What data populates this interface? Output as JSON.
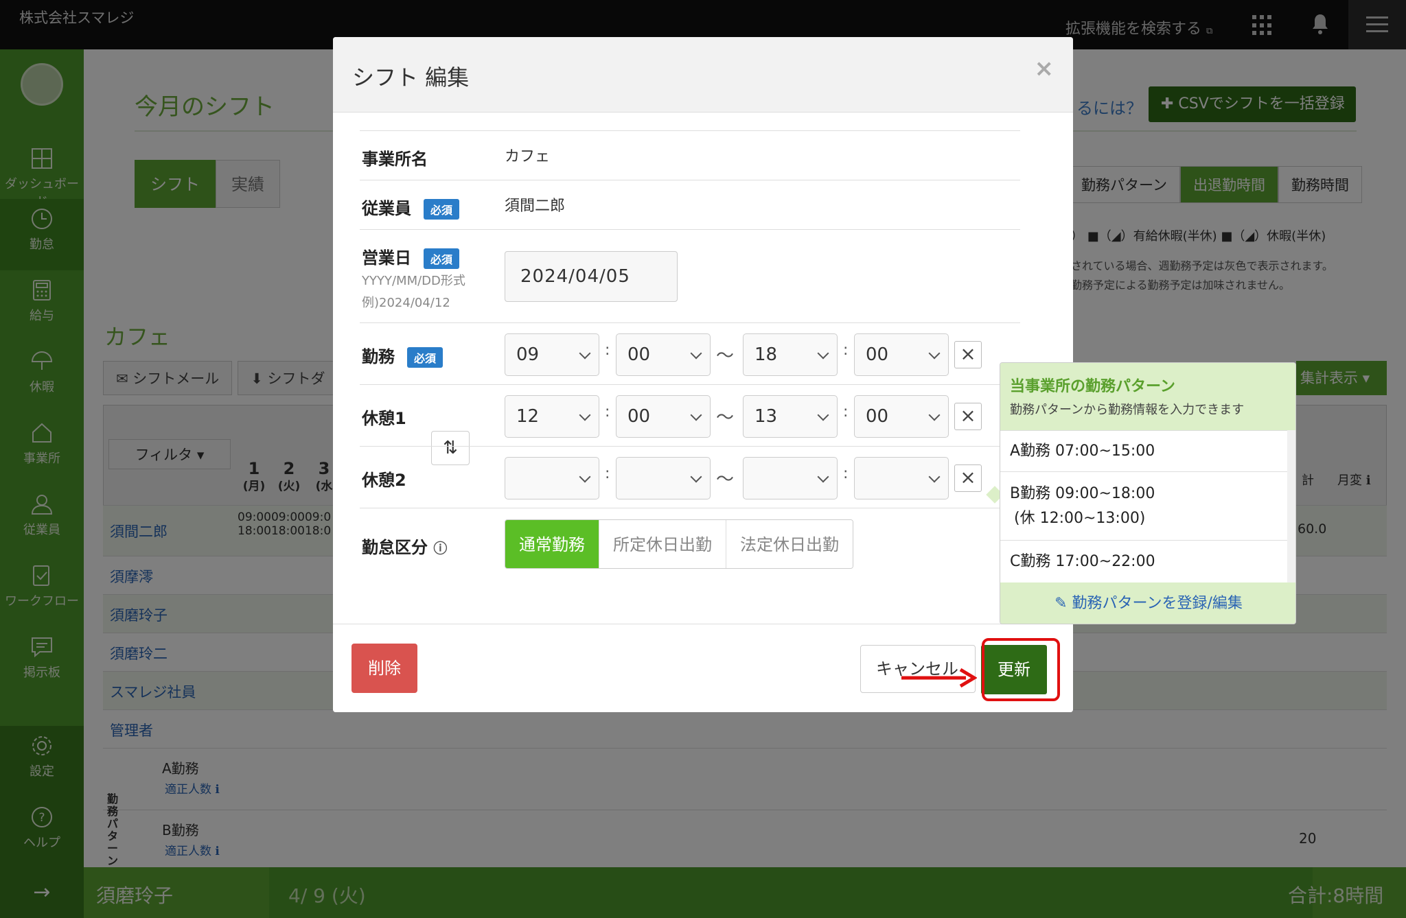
{
  "topbar": {
    "company": "株式会社スマレジ",
    "extension_search": "拡張機能を検索する"
  },
  "sidebar": {
    "items": [
      {
        "label": "ダッシュボード"
      },
      {
        "label": "勤怠"
      },
      {
        "label": "給与"
      },
      {
        "label": "休暇"
      },
      {
        "label": "事業所"
      },
      {
        "label": "従業員"
      },
      {
        "label": "ワークフロー"
      },
      {
        "label": "掲示板"
      },
      {
        "label": "設定"
      },
      {
        "label": "ヘルプ"
      }
    ],
    "collapse": "→"
  },
  "page": {
    "title": "今月のシフト",
    "tabs": [
      "シフト",
      "実績"
    ],
    "help_link": "るには？",
    "csv_button": "✚ CSVでシフトを一括登録",
    "view_tabs": [
      "勤務パターン",
      "出退勤時間",
      "勤務時間"
    ],
    "legend": "） ■（◢）有給休暇(半休)  ■（◢）休暇(半休)",
    "note1": "されている場合、週勤務予定は灰色で表示されます。",
    "note2": "勤務予定による勤務予定は加味されません。",
    "office": "カフェ",
    "buttons": [
      "✉ シフトメール",
      "⬇ シフトダ"
    ],
    "aggregate": "集計表示 ▾"
  },
  "table": {
    "filter": "フィルタ ▾",
    "days": [
      {
        "n": "1",
        "w": "(月)"
      },
      {
        "n": "2",
        "w": "(火)"
      },
      {
        "n": "3",
        "w": "(水"
      }
    ],
    "col_total": "計",
    "col_monthly": "月変",
    "employees": [
      "須間二郎",
      "須摩澪",
      "須磨玲子",
      "須磨玲二",
      "スマレジ社員",
      "管理者"
    ],
    "first_times": "09:0009:0009:0\n18:0018:0018:0",
    "first_total": "60.0",
    "patterns": [
      {
        "name": "A勤務",
        "link": "適正人数"
      },
      {
        "name": "B勤務",
        "link": "適正人数",
        "total": "20"
      }
    ],
    "pattern_section": "勤務パターン集"
  },
  "footer": {
    "name": "須磨玲子",
    "date": "4/ 9 (火)",
    "total": "合計:8時間"
  },
  "modal": {
    "title": "シフト 編集",
    "close": "×",
    "required": "必須",
    "office_label": "事業所名",
    "office_value": "カフェ",
    "employee_label": "従業員",
    "employee_value": "須間二郎",
    "date_label": "営業日",
    "date_hint1": "YYYY/MM/DD形式",
    "date_hint2": "例)2024/04/12",
    "date_value": "2024/04/05",
    "work_label": "勤務",
    "work": {
      "sh": "09",
      "sm": "00",
      "eh": "18",
      "em": "00"
    },
    "break1_label": "休憩1",
    "break1": {
      "sh": "12",
      "sm": "00",
      "eh": "13",
      "em": "00"
    },
    "break2_label": "休憩2",
    "break2": {
      "sh": "",
      "sm": "",
      "eh": "",
      "em": ""
    },
    "kubun_label": "勤怠区分",
    "kubun_options": [
      "通常勤務",
      "所定休日出勤",
      "法定休日出勤"
    ],
    "delete": "削除",
    "cancel": "キャンセル",
    "update": "更新"
  },
  "popover": {
    "title": "当事業所の勤務パターン",
    "subtitle": "勤務パターンから勤務情報を入力できます",
    "items": [
      {
        "line1": "A勤務 07:00~15:00"
      },
      {
        "line1": "B勤務 09:00~18:00",
        "line2": "(休 12:00~13:00)"
      },
      {
        "line1": "C勤務 17:00~22:00"
      }
    ],
    "footer": "✎ 勤務パターンを登録/編集"
  },
  "colors": {
    "brand_green": "#5da533",
    "update_green": "#2e6b16",
    "delete_red": "#d9534f",
    "highlight": "#e01010"
  }
}
